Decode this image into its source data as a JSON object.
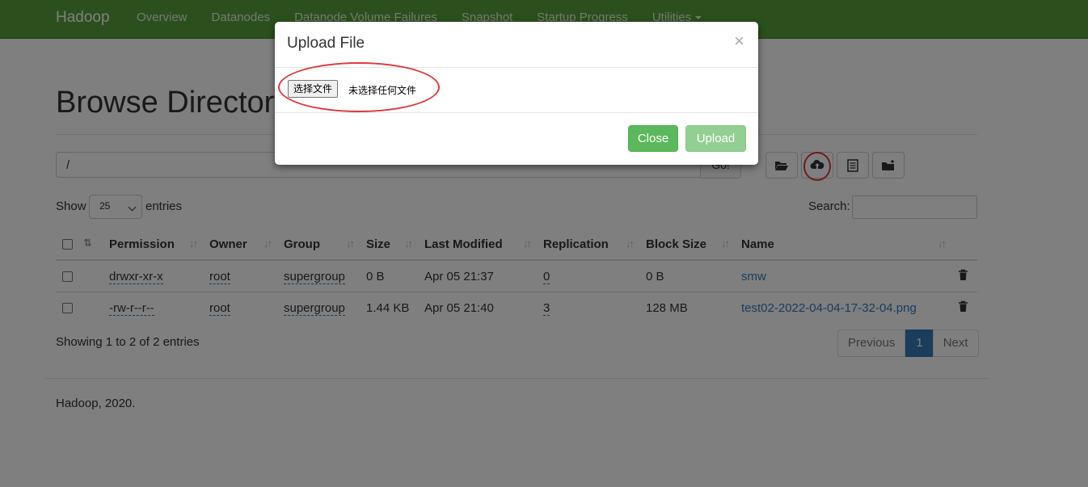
{
  "navbar": {
    "brand": "Hadoop",
    "links": [
      "Overview",
      "Datanodes",
      "Datanode Volume Failures",
      "Snapshot",
      "Startup Progress",
      "Utilities"
    ]
  },
  "page": {
    "title": "Browse Directory",
    "path_value": "/",
    "go_label": "Go!",
    "toolbar_icons": [
      "folder-open-icon",
      "cloud-upload-icon",
      "list-icon",
      "new-folder-icon"
    ]
  },
  "table_controls": {
    "show_label": "Show",
    "entries_value": "25",
    "entries_label": "entries",
    "search_label": "Search:"
  },
  "table": {
    "headers": [
      "Permission",
      "Owner",
      "Group",
      "Size",
      "Last Modified",
      "Replication",
      "Block Size",
      "Name"
    ],
    "rows": [
      {
        "permission": "drwxr-xr-x",
        "owner": "root",
        "group": "supergroup",
        "size": "0 B",
        "modified": "Apr 05 21:37",
        "replication": "0",
        "block_size": "0 B",
        "name": "smw"
      },
      {
        "permission": "-rw-r--r--",
        "owner": "root",
        "group": "supergroup",
        "size": "1.44 KB",
        "modified": "Apr 05 21:40",
        "replication": "3",
        "block_size": "128 MB",
        "name": "test02-2022-04-04-17-32-04.png"
      }
    ]
  },
  "pagination": {
    "showing": "Showing 1 to 2 of 2 entries",
    "previous": "Previous",
    "current": "1",
    "next": "Next"
  },
  "footer": "Hadoop, 2020.",
  "modal": {
    "title": "Upload File",
    "close_x": "×",
    "file_button": "选择文件",
    "file_status": "未选择任何文件",
    "close_label": "Close",
    "upload_label": "Upload"
  },
  "colors": {
    "navbar": "#57a03b",
    "link": "#337ab7",
    "success": "#5cb85c",
    "highlight": "#e0383b"
  }
}
